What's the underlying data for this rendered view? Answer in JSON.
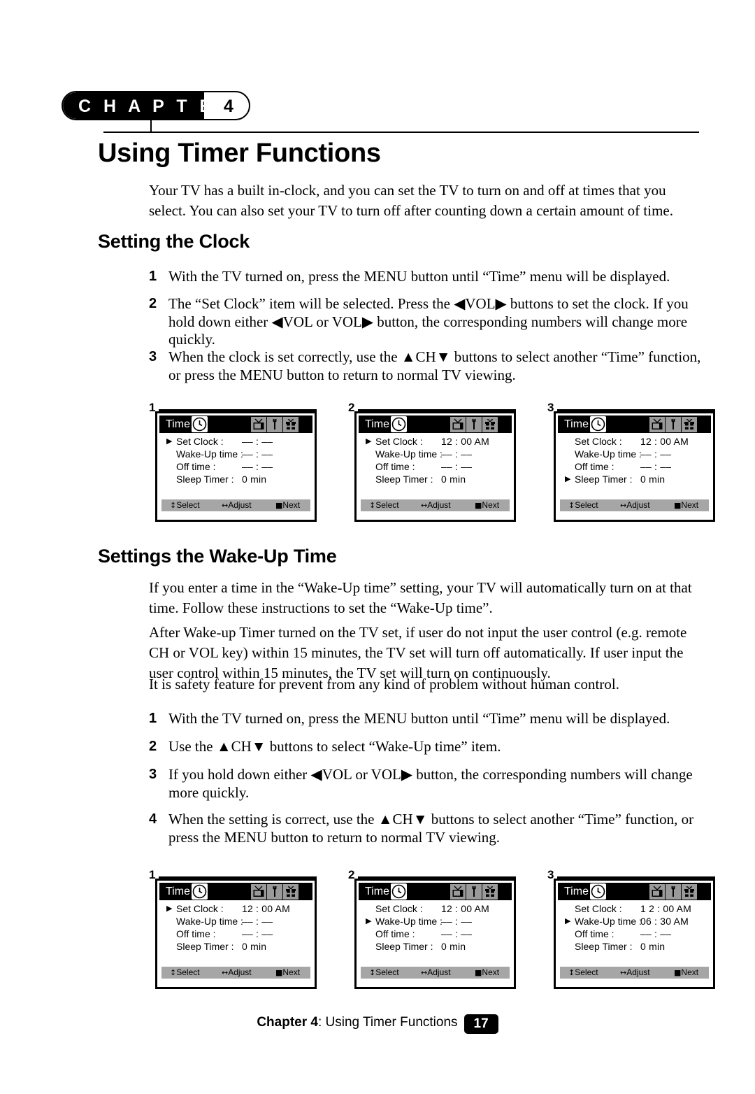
{
  "chapter": {
    "word": "C H A P T E R",
    "number": "4"
  },
  "page_title": "Using Timer Functions",
  "intro_paragraph": "Your TV has a built in-clock, and you can set the TV to turn on and off at times that you select. You can also set your TV to turn off after counting down a certain amount of time.",
  "sections": {
    "clock": {
      "title": "Setting the Clock",
      "steps": [
        {
          "num": "1",
          "text": "With the TV turned on, press the MENU button until “Time” menu will be displayed."
        },
        {
          "num": "2",
          "text": "The “Set Clock” item will be selected. Press the ◀VOL▶ buttons to set the clock. If you hold down either ◀VOL or VOL▶ button, the corresponding numbers will change more quickly."
        },
        {
          "num": "3",
          "text": "When the clock is set correctly, use the ▲CH▼ buttons to select another “Time” function, or press the MENU button to return to normal TV viewing."
        }
      ]
    },
    "wakeup": {
      "title": "Settings the Wake-Up Time",
      "paragraphs": [
        "If you enter a time in the “Wake-Up time” setting, your TV will automatically turn on at that time. Follow these instructions to set the “Wake-Up time”.",
        "After Wake-up Timer turned on the TV set, if user do not input the user control (e.g. remote CH or VOL key) within 15 minutes, the TV set will turn off automatically. If user input the user control within 15 minutes, the TV set will turn on continuously.",
        "It is safety feature for prevent from any kind of problem without human control."
      ],
      "steps": [
        {
          "num": "1",
          "text": "With the TV turned on, press the MENU button until “Time” menu will be displayed."
        },
        {
          "num": "2",
          "text": "Use the ▲CH▼ buttons to select “Wake-Up time” item."
        },
        {
          "num": "3",
          "text": "If you hold down either ◀VOL or VOL▶ button, the corresponding numbers will change more quickly."
        },
        {
          "num": "4",
          "text": "When the setting is correct, use the ▲CH▼ buttons to select another “Time” function, or press the MENU button to return to normal TV viewing."
        }
      ]
    }
  },
  "osd_common": {
    "menu_title": "Time",
    "icons": [
      "clock-icon",
      "tv-icon",
      "wrench-icon",
      "gift-icon"
    ],
    "row_labels": [
      "Set Clock :",
      "Wake-Up time :",
      "Off time :",
      "Sleep Timer :"
    ],
    "footer": [
      {
        "glyph": "↕",
        "label": "Select"
      },
      {
        "glyph": "↔",
        "label": "Adjust"
      },
      {
        "glyph": "■",
        "label": "Next"
      }
    ],
    "cursor_glyph": "▶",
    "blank_time": "–– : ––"
  },
  "figures_clock": [
    {
      "index": "1",
      "title": "Time",
      "selected_row": 0,
      "values": [
        "–– : ––",
        "–– : ––",
        "–– : ––",
        "0 min"
      ]
    },
    {
      "index": "2",
      "title": "Time",
      "selected_row": 0,
      "values": [
        "12 : 00 AM",
        "–– : ––",
        "–– : ––",
        "0 min"
      ]
    },
    {
      "index": "3",
      "title": "Time",
      "selected_row": 3,
      "values": [
        "12 : 00 AM",
        "–– : ––",
        "–– : ––",
        "0 min"
      ]
    }
  ],
  "figures_wakeup": [
    {
      "index": "1",
      "title": "Time",
      "selected_row": 0,
      "values": [
        "12 : 00 AM",
        "–– : ––",
        "–– : ––",
        "0 min"
      ]
    },
    {
      "index": "2",
      "title": "Time",
      "selected_row": 1,
      "values": [
        "12 : 00 AM",
        "–– : ––",
        "–– : ––",
        "0 min"
      ]
    },
    {
      "index": "3",
      "title": "Time",
      "selected_row": 2,
      "values": [
        "1 2 : 00 AM",
        "06 : 30 AM",
        "–– : ––",
        "0 min"
      ]
    }
  ],
  "footer": {
    "chapter_label": "Chapter 4",
    "separator": ": ",
    "title": "Using Timer Functions",
    "page_number": "17"
  },
  "colors": {
    "osd_title_bg": "#000000",
    "osd_icon_bg": "#9a9a9a",
    "osd_footer_bg": "#a6a6a6",
    "text": "#000000",
    "page_bg": "#ffffff"
  }
}
